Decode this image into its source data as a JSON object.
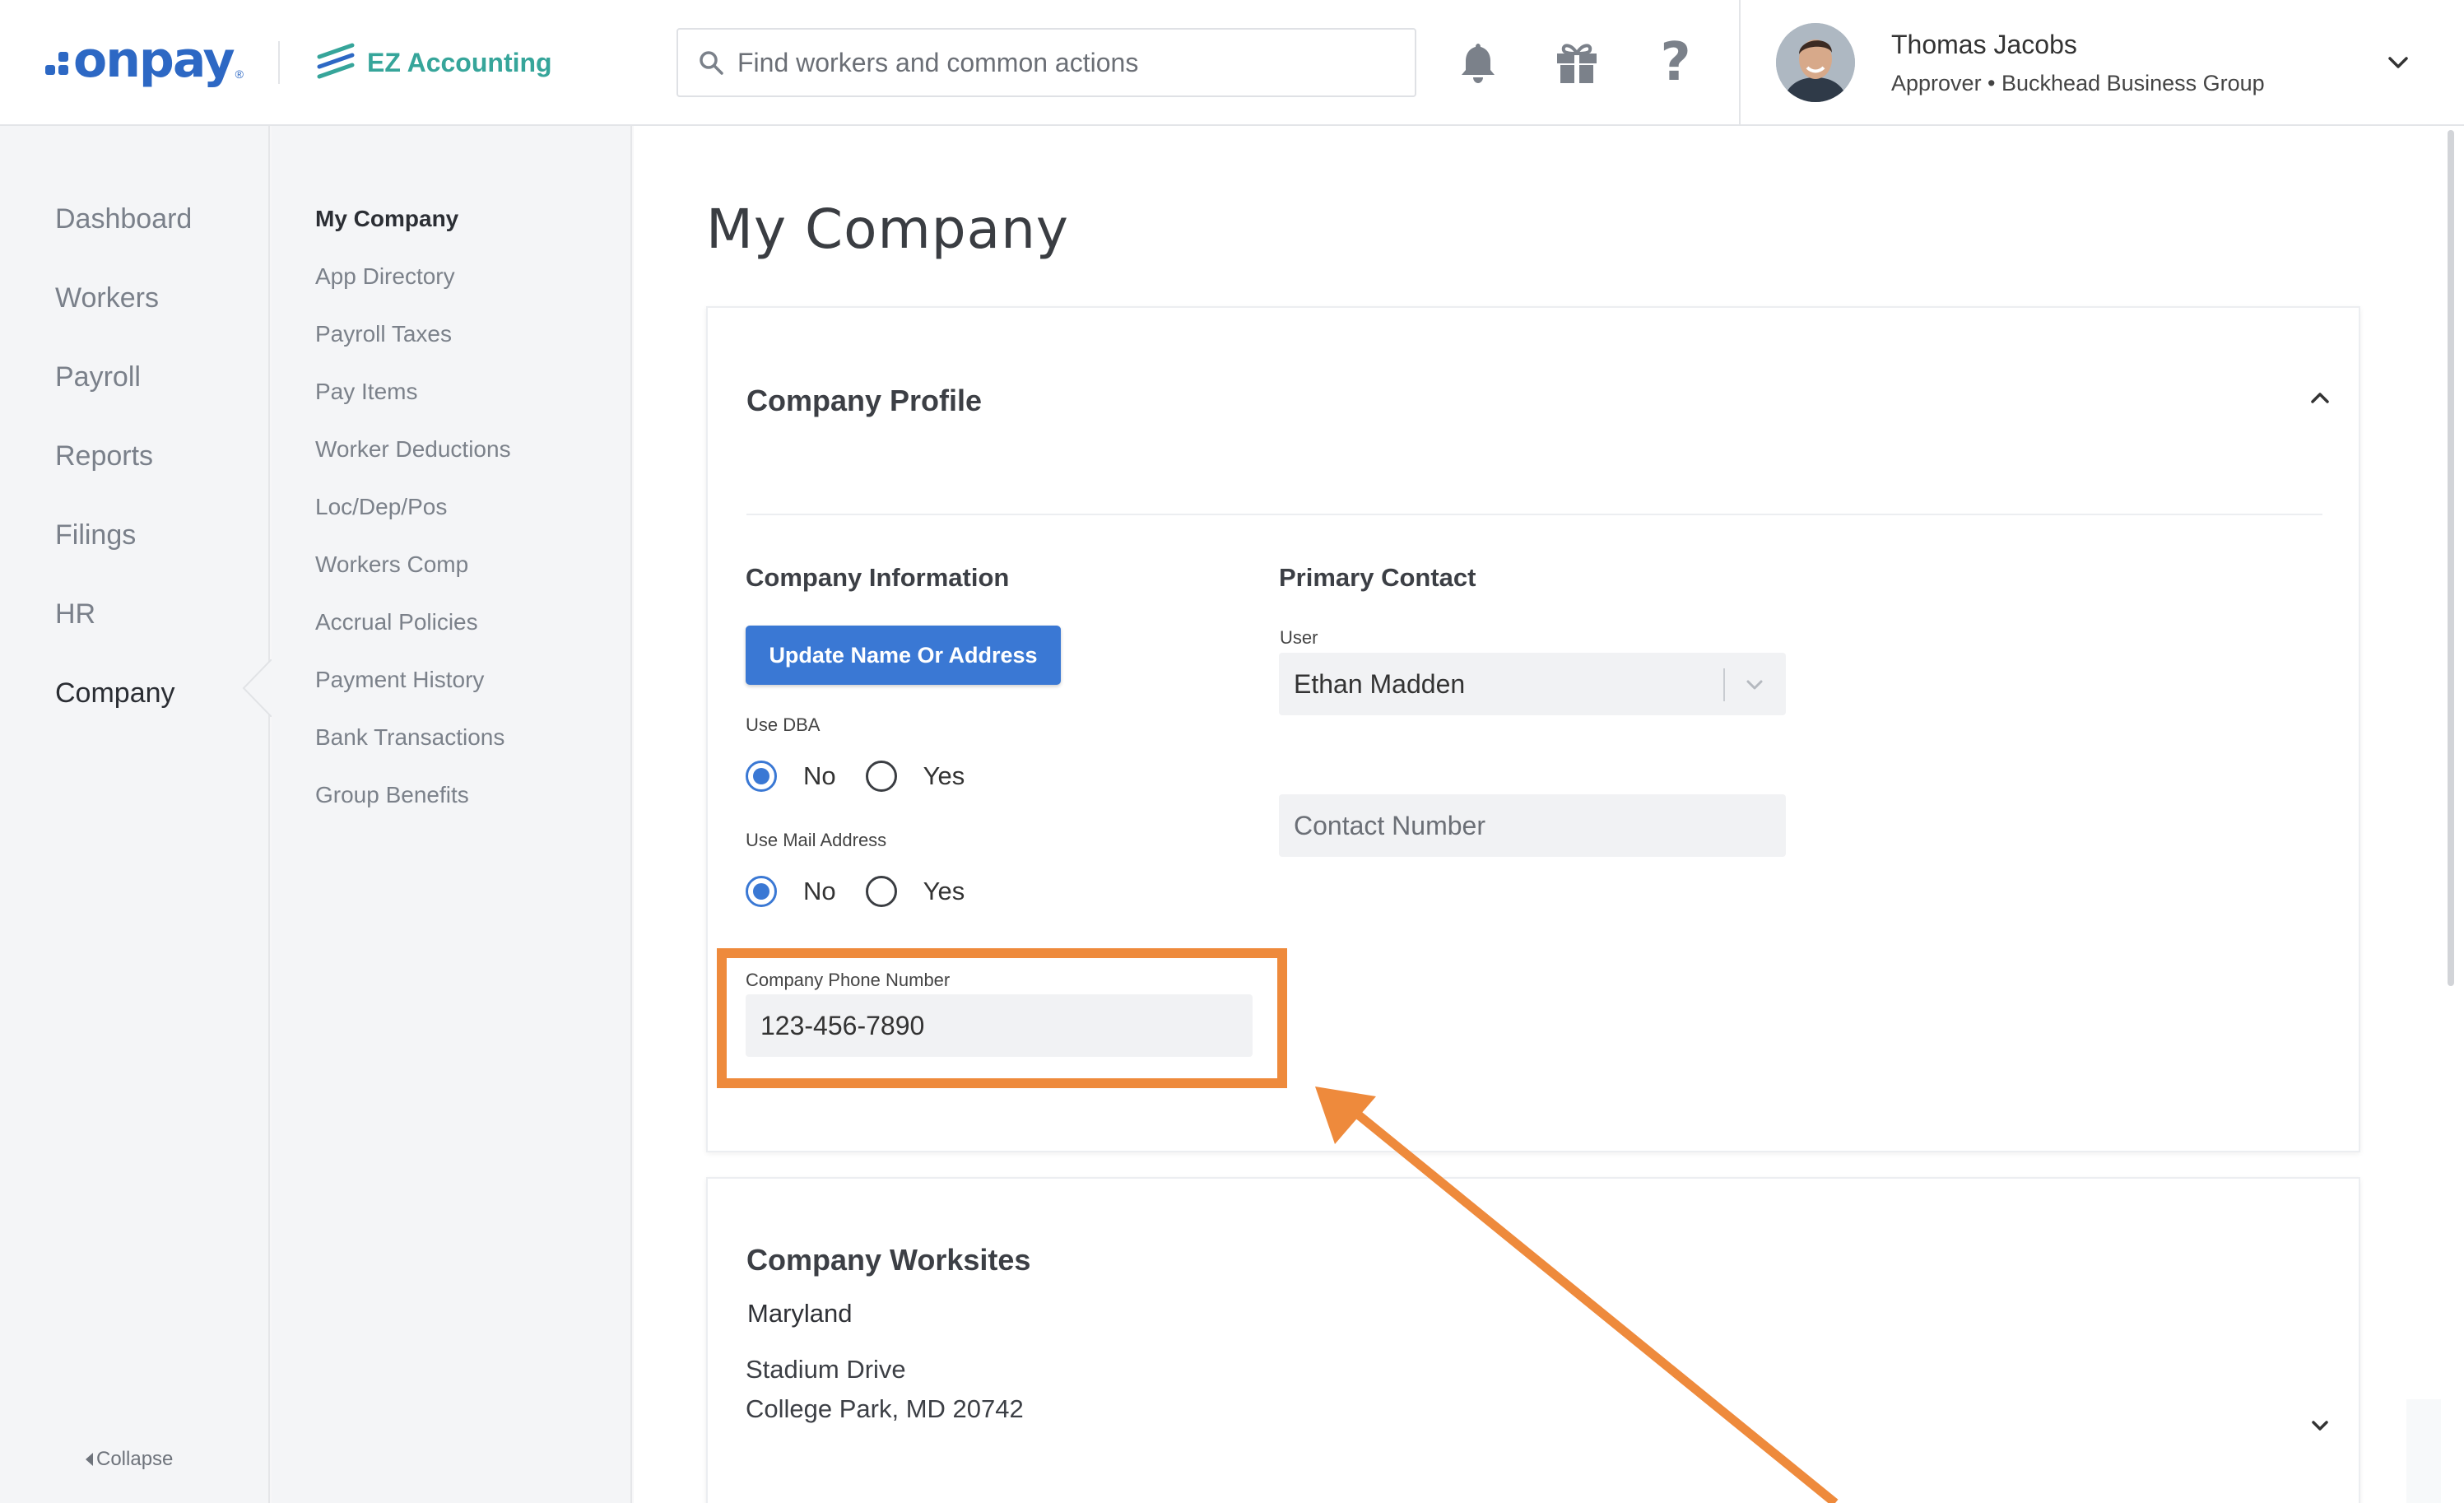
{
  "brand": {
    "logo_text": "onpay",
    "logo_mark": "®",
    "partner_name": "EZ Accounting",
    "accent_color": "#2d68c4",
    "partner_color": "#36a59a"
  },
  "search": {
    "placeholder": "Find workers and common actions",
    "icon": "search-icon"
  },
  "header_icons": [
    "bell-icon",
    "gift-icon",
    "help-icon"
  ],
  "user": {
    "name": "Thomas Jacobs",
    "role": "Approver • Buckhead Business Group"
  },
  "left_nav": {
    "items": [
      {
        "label": "Dashboard",
        "active": false
      },
      {
        "label": "Workers",
        "active": false
      },
      {
        "label": "Payroll",
        "active": false
      },
      {
        "label": "Reports",
        "active": false
      },
      {
        "label": "Filings",
        "active": false
      },
      {
        "label": "HR",
        "active": false
      },
      {
        "label": "Company",
        "active": true
      }
    ],
    "collapse_label": "Collapse"
  },
  "sub_nav": {
    "items": [
      {
        "label": "My Company",
        "active": true
      },
      {
        "label": "App Directory",
        "active": false
      },
      {
        "label": "Payroll Taxes",
        "active": false
      },
      {
        "label": "Pay Items",
        "active": false
      },
      {
        "label": "Worker Deductions",
        "active": false
      },
      {
        "label": "Loc/Dep/Pos",
        "active": false
      },
      {
        "label": "Workers Comp",
        "active": false
      },
      {
        "label": "Accrual Policies",
        "active": false
      },
      {
        "label": "Payment History",
        "active": false
      },
      {
        "label": "Bank Transactions",
        "active": false
      },
      {
        "label": "Group Benefits",
        "active": false
      }
    ]
  },
  "page": {
    "title": "My Company",
    "profile": {
      "title": "Company Profile",
      "company_info": {
        "title": "Company Information",
        "update_button": "Update Name Or Address",
        "use_dba": {
          "label": "Use DBA",
          "options": [
            "No",
            "Yes"
          ],
          "selected": "No"
        },
        "use_mail": {
          "label": "Use Mail Address",
          "options": [
            "No",
            "Yes"
          ],
          "selected": "No"
        },
        "phone": {
          "label": "Company Phone Number",
          "value": "123-456-7890"
        }
      },
      "primary_contact": {
        "title": "Primary Contact",
        "user_label": "User",
        "user_value": "Ethan Madden",
        "contact_number_placeholder": "Contact Number"
      }
    },
    "worksites": {
      "title": "Company Worksites",
      "name": "Maryland",
      "address_line1": "Stadium Drive",
      "address_line2": "College Park, MD 20742"
    }
  },
  "annotation_color": "#ee8a3c"
}
